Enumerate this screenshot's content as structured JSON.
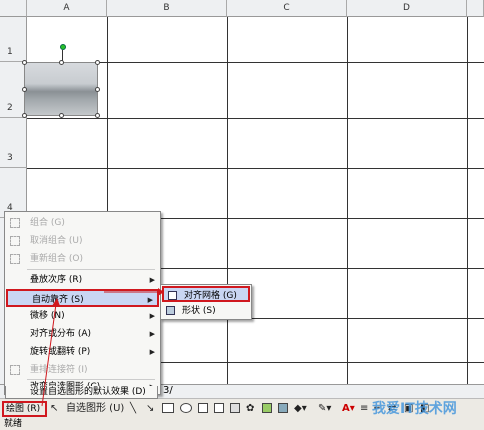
{
  "columns": [
    "A",
    "B",
    "C",
    "D"
  ],
  "rows": [
    "1",
    "2",
    "3",
    "4"
  ],
  "context_menu": {
    "items": [
      {
        "label": "组合 (G)",
        "disabled": true
      },
      {
        "label": "取消组合 (U)",
        "disabled": true
      },
      {
        "label": "重新组合 (O)",
        "disabled": true
      },
      {
        "label": "叠放次序 (R)",
        "submenu": true
      },
      {
        "label": "自动靠齐 (S)",
        "submenu": true,
        "highlighted": true
      },
      {
        "label": "微移 (N)",
        "submenu": true
      },
      {
        "label": "对齐或分布 (A)",
        "submenu": true
      },
      {
        "label": "旋转或翻转 (P)",
        "submenu": true
      },
      {
        "label": "重排连接符 (I)",
        "disabled": true
      },
      {
        "label": "改变自选图形 (C)",
        "submenu": true
      },
      {
        "label": "设置自选图形的默认效果 (D)"
      }
    ]
  },
  "submenu": {
    "items": [
      {
        "label": "对齐网格 (G)",
        "highlighted": true
      },
      {
        "label": "形状 (S)"
      }
    ]
  },
  "toolbar": {
    "draw_label": "绘图 (R)",
    "autoshape_label": "自选图形 (U)"
  },
  "sheet_tab_fragment": "3/",
  "status_text": "就绪",
  "watermark": "我爱IT技术网",
  "colors": {
    "highlight": "#c9d6f3",
    "annotation_red": "#d0181e"
  }
}
